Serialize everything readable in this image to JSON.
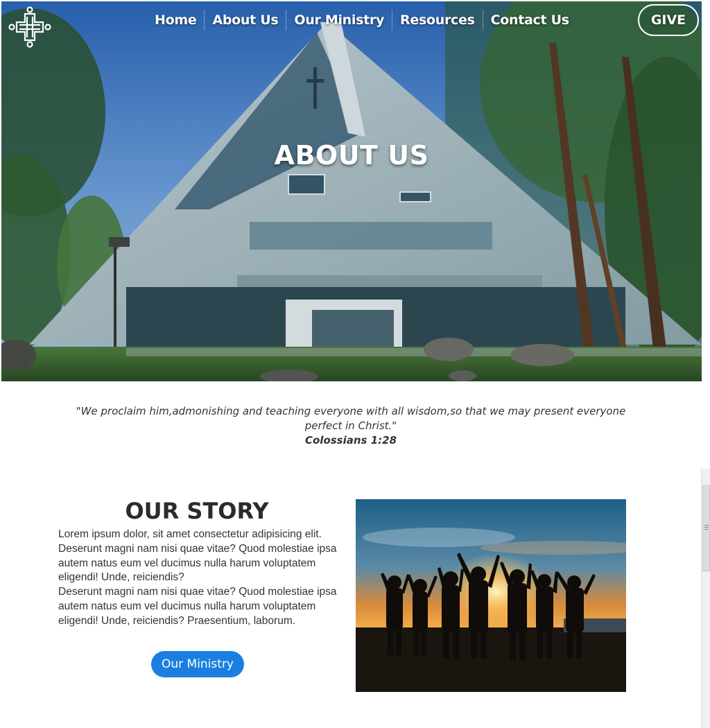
{
  "nav": {
    "items": [
      "Home",
      "About Us",
      "Our Ministry",
      "Resources",
      "Contact Us"
    ],
    "give_label": "GIVE"
  },
  "hero": {
    "title": "ABOUT US"
  },
  "quote": {
    "text": "\"We proclaim him,admonishing and teaching everyone with all wisdom,so that we may present everyone perfect in Christ.\"",
    "reference": "Colossians 1:28"
  },
  "story": {
    "title": "OUR STORY",
    "body": "Lorem ipsum dolor, sit amet consectetur adipisicing elit. Deserunt magni nam nisi quae vitae? Quod molestiae ipsa autem natus eum vel ducimus nulla harum voluptatem eligendi! Unde, reiciendis?",
    "body2": "Deserunt magni nam nisi quae vitae? Quod molestiae ipsa autem natus eum vel ducimus nulla harum voluptatem eligendi! Unde, reiciendis? Praesentium, laborum.",
    "button_label": "Our Ministry"
  },
  "colors": {
    "accent": "#1a7fe0",
    "text": "#333333"
  },
  "icons": {
    "logo": "cross-logo-icon"
  }
}
